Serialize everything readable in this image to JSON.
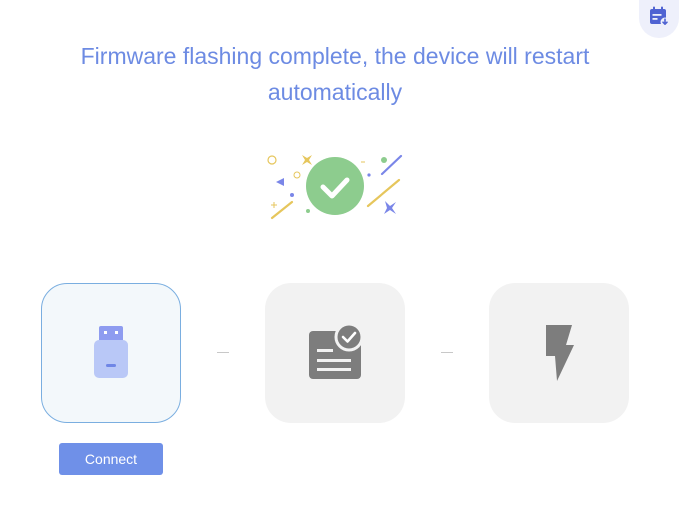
{
  "header": {
    "title_line1": "Firmware flashing complete, the device will restart",
    "title_line2": "automatically"
  },
  "corner_action": {
    "icon": "calendar-download-icon"
  },
  "status": {
    "icon": "success-check-icon",
    "accent": "#8dcc8e"
  },
  "steps": [
    {
      "icon": "usb-device-icon",
      "state": "active",
      "color": "#b9c8f7"
    },
    {
      "icon": "document-check-icon",
      "state": "inactive",
      "color": "#7d7d7d"
    },
    {
      "icon": "lightning-icon",
      "state": "inactive",
      "color": "#7d7d7d"
    }
  ],
  "actions": {
    "connect_label": "Connect"
  },
  "colors": {
    "primary": "#6f90e8",
    "title": "#6d8be3",
    "card_bg": "#f2f2f2",
    "active_border": "#7aaee0"
  }
}
